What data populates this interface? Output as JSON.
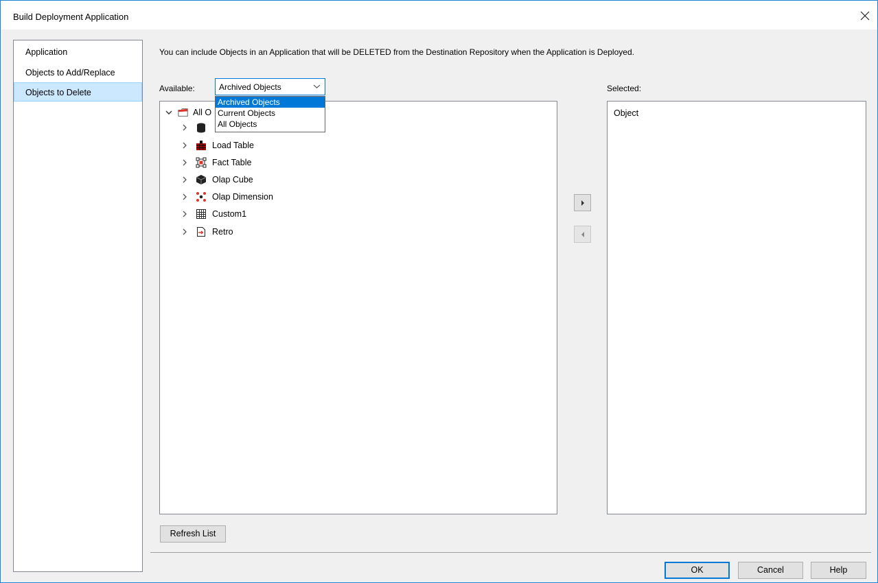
{
  "window": {
    "title": "Build Deployment Application",
    "close_symbol": "close"
  },
  "nav": {
    "items": [
      {
        "label": "Application"
      },
      {
        "label": "Objects to Add/Replace"
      },
      {
        "label": "Objects to Delete",
        "selected": true
      }
    ]
  },
  "description": "You can include Objects in an Application that will be DELETED from the Destination Repository when the Application is Deployed.",
  "available": {
    "label": "Available:",
    "combo_value": "Archived Objects",
    "options": [
      "Archived Objects",
      "Current Objects",
      "All Objects"
    ],
    "highlighted_option": "Archived Objects"
  },
  "tree": {
    "root_label": "All O",
    "items": [
      {
        "label": "",
        "icon": "database-icon"
      },
      {
        "label": "Load Table",
        "icon": "load-table-icon"
      },
      {
        "label": "Fact Table",
        "icon": "fact-table-icon"
      },
      {
        "label": "Olap Cube",
        "icon": "olap-cube-icon"
      },
      {
        "label": "Olap Dimension",
        "icon": "olap-dimension-icon"
      },
      {
        "label": "Custom1",
        "icon": "grid-icon"
      },
      {
        "label": "Retro",
        "icon": "retro-icon"
      }
    ]
  },
  "selected": {
    "label": "Selected:",
    "items": [
      "Object"
    ]
  },
  "buttons": {
    "refresh": "Refresh List",
    "ok": "OK",
    "cancel": "Cancel",
    "help": "Help"
  },
  "colors": {
    "accent": "#0078d7",
    "nav_selected": "#cce8ff",
    "window_border": "#1883d7"
  }
}
